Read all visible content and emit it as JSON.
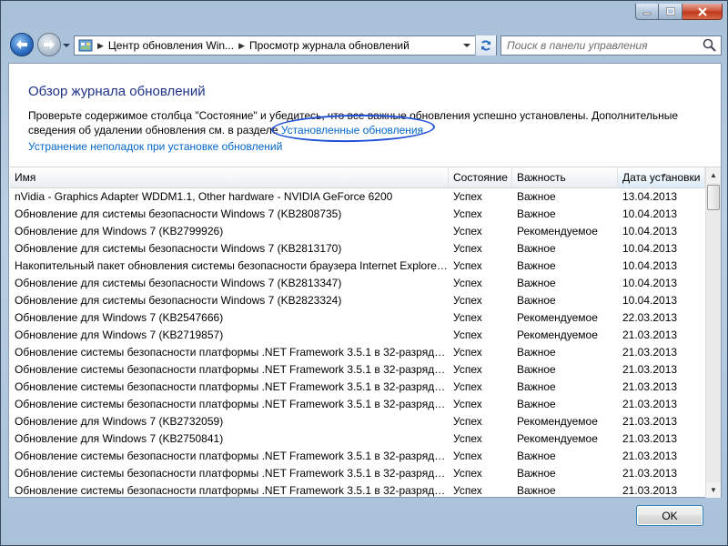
{
  "address_bar": {
    "segments": [
      "Центр обновления Win...",
      "Просмотр журнала обновлений"
    ]
  },
  "search": {
    "placeholder": "Поиск в панели управления"
  },
  "page": {
    "title": "Обзор журнала обновлений",
    "description_part1": "Проверьте содержимое столбца \"Состояние\" и убедитесь, что все важные обновления успешно установлены. Дополнительные сведения об удалении обновления см. в разделе ",
    "installed_updates_link": "Установленные обновления",
    "description_end": ".",
    "troubleshoot_link": "Устранение неполадок при установке обновлений"
  },
  "list": {
    "columns": [
      "Имя",
      "Состояние",
      "Важность",
      "Дата установки"
    ],
    "rows": [
      [
        "nVidia - Graphics Adapter WDDM1.1, Other hardware - NVIDIA GeForce 6200",
        "Успех",
        "Важное",
        "13.04.2013"
      ],
      [
        "Обновление для системы безопасности Windows 7 (KB2808735)",
        "Успех",
        "Важное",
        "10.04.2013"
      ],
      [
        "Обновление для Windows 7 (KB2799926)",
        "Успех",
        "Рекомендуемое",
        "10.04.2013"
      ],
      [
        "Обновление для системы безопасности Windows 7 (KB2813170)",
        "Успех",
        "Важное",
        "10.04.2013"
      ],
      [
        "Накопительный пакет обновления системы безопасности браузера Internet Explorer ...",
        "Успех",
        "Важное",
        "10.04.2013"
      ],
      [
        "Обновление для системы безопасности Windows 7 (KB2813347)",
        "Успех",
        "Важное",
        "10.04.2013"
      ],
      [
        "Обновление для системы безопасности Windows 7 (KB2823324)",
        "Успех",
        "Важное",
        "10.04.2013"
      ],
      [
        "Обновление для Windows 7 (KB2547666)",
        "Успех",
        "Рекомендуемое",
        "22.03.2013"
      ],
      [
        "Обновление для Windows 7 (KB2719857)",
        "Успех",
        "Рекомендуемое",
        "21.03.2013"
      ],
      [
        "Обновление системы безопасности платформы .NET Framework 3.5.1 в 32-разрядно...",
        "Успех",
        "Важное",
        "21.03.2013"
      ],
      [
        "Обновление системы безопасности платформы .NET Framework 3.5.1 в 32-разрядно...",
        "Успех",
        "Важное",
        "21.03.2013"
      ],
      [
        "Обновление системы безопасности платформы .NET Framework 3.5.1 в 32-разрядно...",
        "Успех",
        "Важное",
        "21.03.2013"
      ],
      [
        "Обновление системы безопасности платформы .NET Framework 3.5.1 в 32-разрядно...",
        "Успех",
        "Важное",
        "21.03.2013"
      ],
      [
        "Обновление для Windows 7 (KB2732059)",
        "Успех",
        "Рекомендуемое",
        "21.03.2013"
      ],
      [
        "Обновление для Windows 7 (KB2750841)",
        "Успех",
        "Рекомендуемое",
        "21.03.2013"
      ],
      [
        "Обновление системы безопасности платформы .NET Framework 3.5.1 в 32-разрядно...",
        "Успех",
        "Важное",
        "21.03.2013"
      ],
      [
        "Обновление системы безопасности платформы .NET Framework 3.5.1 в 32-разрядно...",
        "Успех",
        "Важное",
        "21.03.2013"
      ],
      [
        "Обновление системы безопасности платформы .NET Framework 3.5.1 в 32-разрядно...",
        "Успех",
        "Важное",
        "21.03.2013"
      ]
    ]
  },
  "footer": {
    "ok_label": "OK"
  },
  "colors": {
    "title": "#1e3287",
    "link": "#0066cc",
    "annotation_circle": "#2050d8"
  }
}
